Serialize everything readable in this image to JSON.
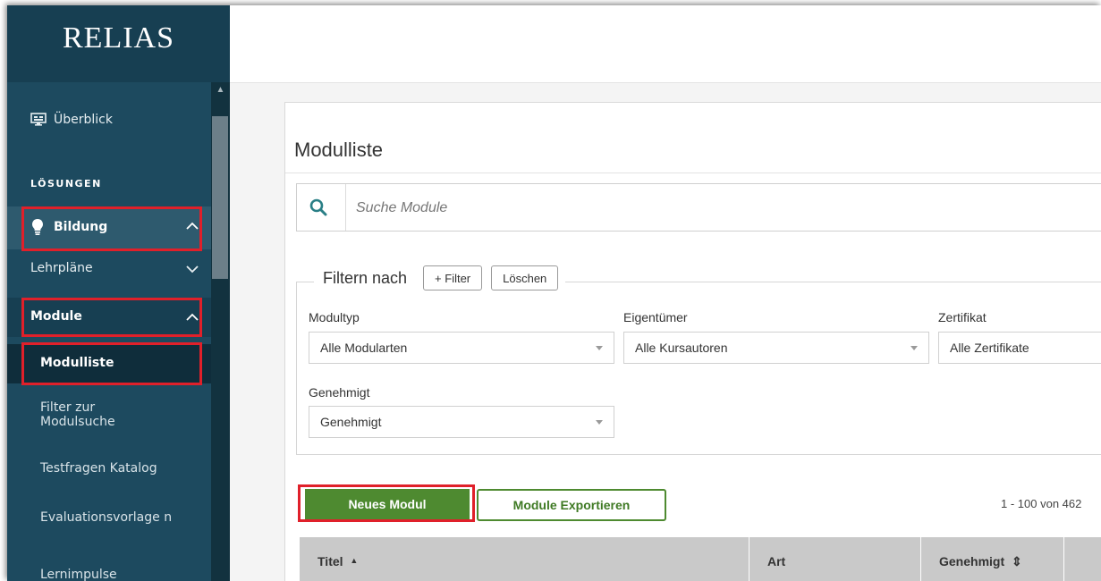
{
  "brand": {
    "logo_text": "RELIAS"
  },
  "sidebar": {
    "overview_label": "Überblick",
    "section_title": "LÖSUNGEN",
    "bildung_label": "Bildung",
    "lehrplaene_label": "Lehrpläne",
    "module_label": "Module",
    "sub_items": {
      "modulliste": "Modulliste",
      "filter_zur_modulsuche": "Filter zur Modulsuche",
      "testfragen_katalog": "Testfragen Katalog",
      "evaluationsvorlagen": "Evaluationsvorlage n",
      "lernimpulse": "Lernimpulse"
    },
    "icons": {
      "overview": "monitor-icon",
      "bildung": "lightbulb-icon",
      "expand": "chevron-icon"
    }
  },
  "main": {
    "title": "Modulliste",
    "search": {
      "placeholder": "Suche Module",
      "value": ""
    },
    "filter": {
      "legend": "Filtern nach",
      "add_filter_label": "+ Filter",
      "clear_label": "Löschen",
      "modultyp": {
        "label": "Modultyp",
        "value": "Alle Modularten"
      },
      "eigentuemer": {
        "label": "Eigentümer",
        "value": "Alle Kursautoren"
      },
      "zertifikat": {
        "label": "Zertifikat",
        "value": "Alle Zertifikate"
      },
      "genehmigt": {
        "label": "Genehmigt",
        "value": "Genehmigt"
      }
    },
    "actions": {
      "new_module": "Neues Modul",
      "export_modules": "Module Exportieren"
    },
    "paging_text": "1 - 100 von 462",
    "table": {
      "columns": [
        {
          "label": "Titel",
          "sort": "▲"
        },
        {
          "label": "Art",
          "sort": ""
        },
        {
          "label": "Genehmigt",
          "sort": "⇕"
        }
      ]
    }
  },
  "colors": {
    "sidebar_bg": "#1d4a5f",
    "highlight": "#e0202a",
    "primary_green": "#4e8a30",
    "search_icon": "#2a7f86"
  }
}
